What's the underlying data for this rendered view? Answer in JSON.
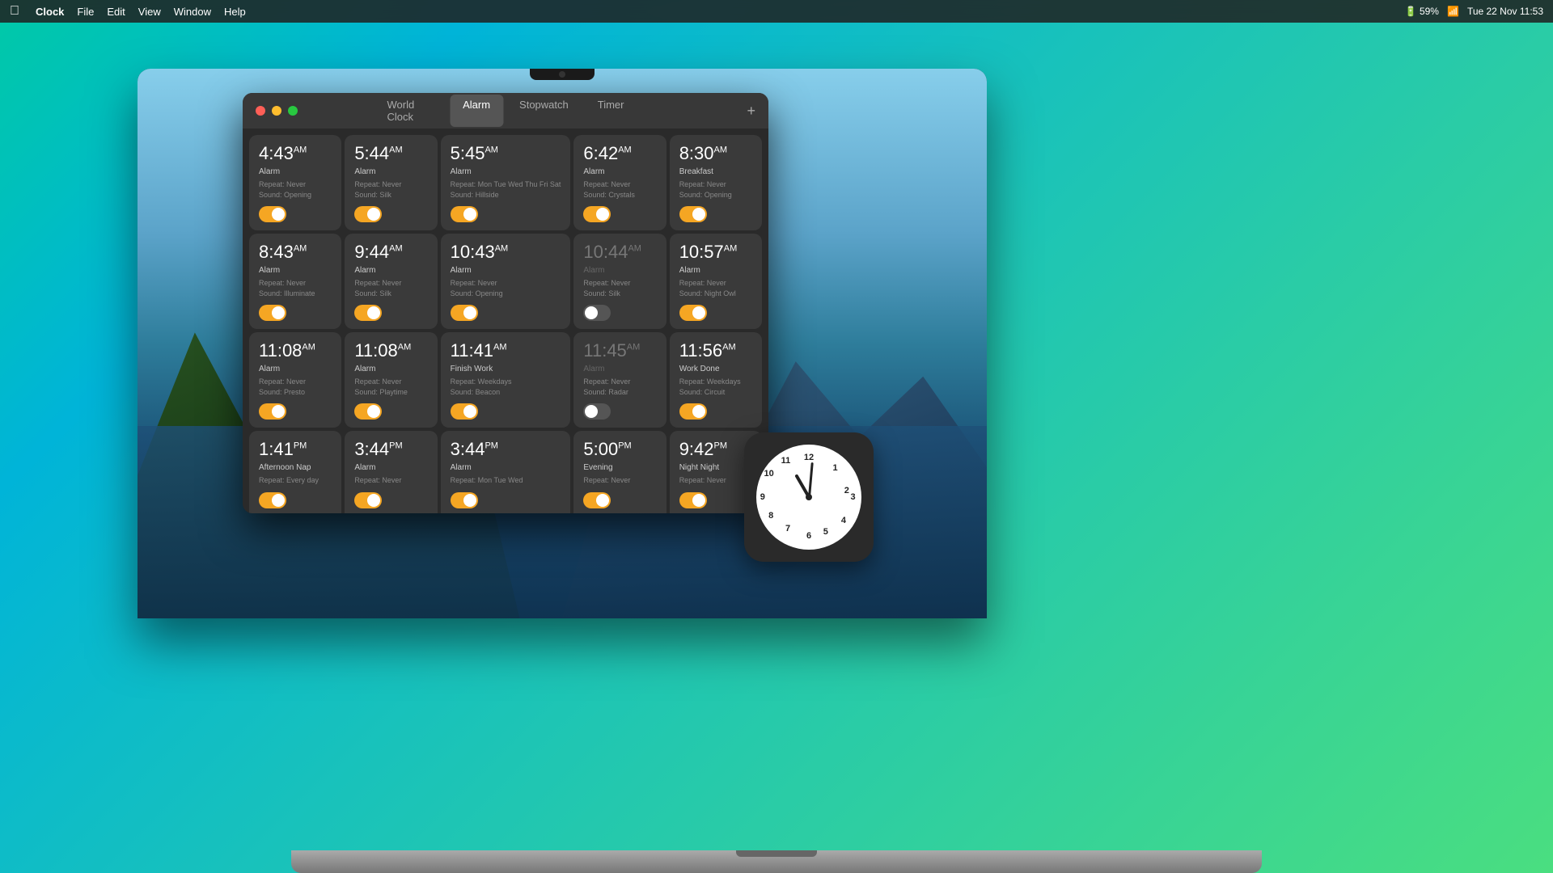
{
  "menubar": {
    "apple": "&#63743;",
    "app_name": "Clock",
    "menus": [
      "File",
      "Edit",
      "View",
      "Window",
      "Help"
    ],
    "right": {
      "datetime": "Tue 22 Nov  11:53",
      "battery": "59%"
    }
  },
  "window": {
    "title": "Clock",
    "tabs": [
      {
        "label": "World Clock",
        "active": false
      },
      {
        "label": "Alarm",
        "active": true
      },
      {
        "label": "Stopwatch",
        "active": false
      },
      {
        "label": "Timer",
        "active": false
      }
    ],
    "add_button": "+"
  },
  "alarms": [
    {
      "time": "4:43",
      "ampm": "AM",
      "label": "Alarm",
      "repeat": "Never",
      "sound": "Opening",
      "enabled": true,
      "disabled_style": false
    },
    {
      "time": "5:44",
      "ampm": "AM",
      "label": "Alarm",
      "repeat": "Never",
      "sound": "Silk",
      "enabled": true,
      "disabled_style": false
    },
    {
      "time": "5:45",
      "ampm": "AM",
      "label": "Alarm",
      "repeat": "Mon Tue Wed Thu Fri Sat",
      "sound": "Hillside",
      "enabled": true,
      "disabled_style": false
    },
    {
      "time": "6:42",
      "ampm": "AM",
      "label": "Alarm",
      "repeat": "Never",
      "sound": "Crystals",
      "enabled": true,
      "disabled_style": false
    },
    {
      "time": "8:30",
      "ampm": "AM",
      "label": "Breakfast",
      "repeat": "Never",
      "sound": "Opening",
      "enabled": true,
      "disabled_style": false
    },
    {
      "time": "8:43",
      "ampm": "AM",
      "label": "Alarm",
      "repeat": "Never",
      "sound": "Illuminate",
      "enabled": true,
      "disabled_style": false
    },
    {
      "time": "9:44",
      "ampm": "AM",
      "label": "Alarm",
      "repeat": "Never",
      "sound": "Silk",
      "enabled": true,
      "disabled_style": false
    },
    {
      "time": "10:43",
      "ampm": "AM",
      "label": "Alarm",
      "repeat": "Never",
      "sound": "Opening",
      "enabled": true,
      "disabled_style": false
    },
    {
      "time": "10:44",
      "ampm": "AM",
      "label": "Alarm",
      "repeat": "Never",
      "sound": "Silk",
      "enabled": false,
      "disabled_style": true
    },
    {
      "time": "10:57",
      "ampm": "AM",
      "label": "Alarm",
      "repeat": "Never",
      "sound": "Night Owl",
      "enabled": true,
      "disabled_style": false
    },
    {
      "time": "11:08",
      "ampm": "AM",
      "label": "Alarm",
      "repeat": "Never",
      "sound": "Presto",
      "enabled": true,
      "disabled_style": false
    },
    {
      "time": "11:08",
      "ampm": "AM",
      "label": "Alarm",
      "repeat": "Never",
      "sound": "Playtime",
      "enabled": true,
      "disabled_style": false
    },
    {
      "time": "11:41",
      "ampm": "AM",
      "label": "Finish Work",
      "repeat": "Weekdays",
      "sound": "Beacon",
      "enabled": true,
      "disabled_style": false
    },
    {
      "time": "11:45",
      "ampm": "AM",
      "label": "Alarm",
      "repeat": "Never",
      "sound": "Radar",
      "enabled": false,
      "disabled_style": true
    },
    {
      "time": "11:56",
      "ampm": "AM",
      "label": "Work Done",
      "repeat": "Weekdays",
      "sound": "Circuit",
      "enabled": true,
      "disabled_style": false
    },
    {
      "time": "1:41",
      "ampm": "PM",
      "label": "Afternoon Nap",
      "repeat": "Every day",
      "sound": "",
      "enabled": true,
      "disabled_style": false
    },
    {
      "time": "3:44",
      "ampm": "PM",
      "label": "Alarm",
      "repeat": "Never",
      "sound": "",
      "enabled": true,
      "disabled_style": false
    },
    {
      "time": "3:44",
      "ampm": "PM",
      "label": "Alarm",
      "repeat": "Mon Tue Wed",
      "sound": "",
      "enabled": true,
      "disabled_style": false
    },
    {
      "time": "5:00",
      "ampm": "PM",
      "label": "Evening",
      "repeat": "Never",
      "sound": "",
      "enabled": true,
      "disabled_style": false
    },
    {
      "time": "9:42",
      "ampm": "PM",
      "label": "Night Night",
      "repeat": "Never",
      "sound": "",
      "enabled": true,
      "disabled_style": false
    }
  ],
  "clock_widget": {
    "hour_rotation": -60,
    "minute_rotation": 60,
    "numbers": [
      "12",
      "1",
      "2",
      "3",
      "4",
      "5",
      "6",
      "7",
      "8",
      "9",
      "10",
      "11"
    ]
  }
}
